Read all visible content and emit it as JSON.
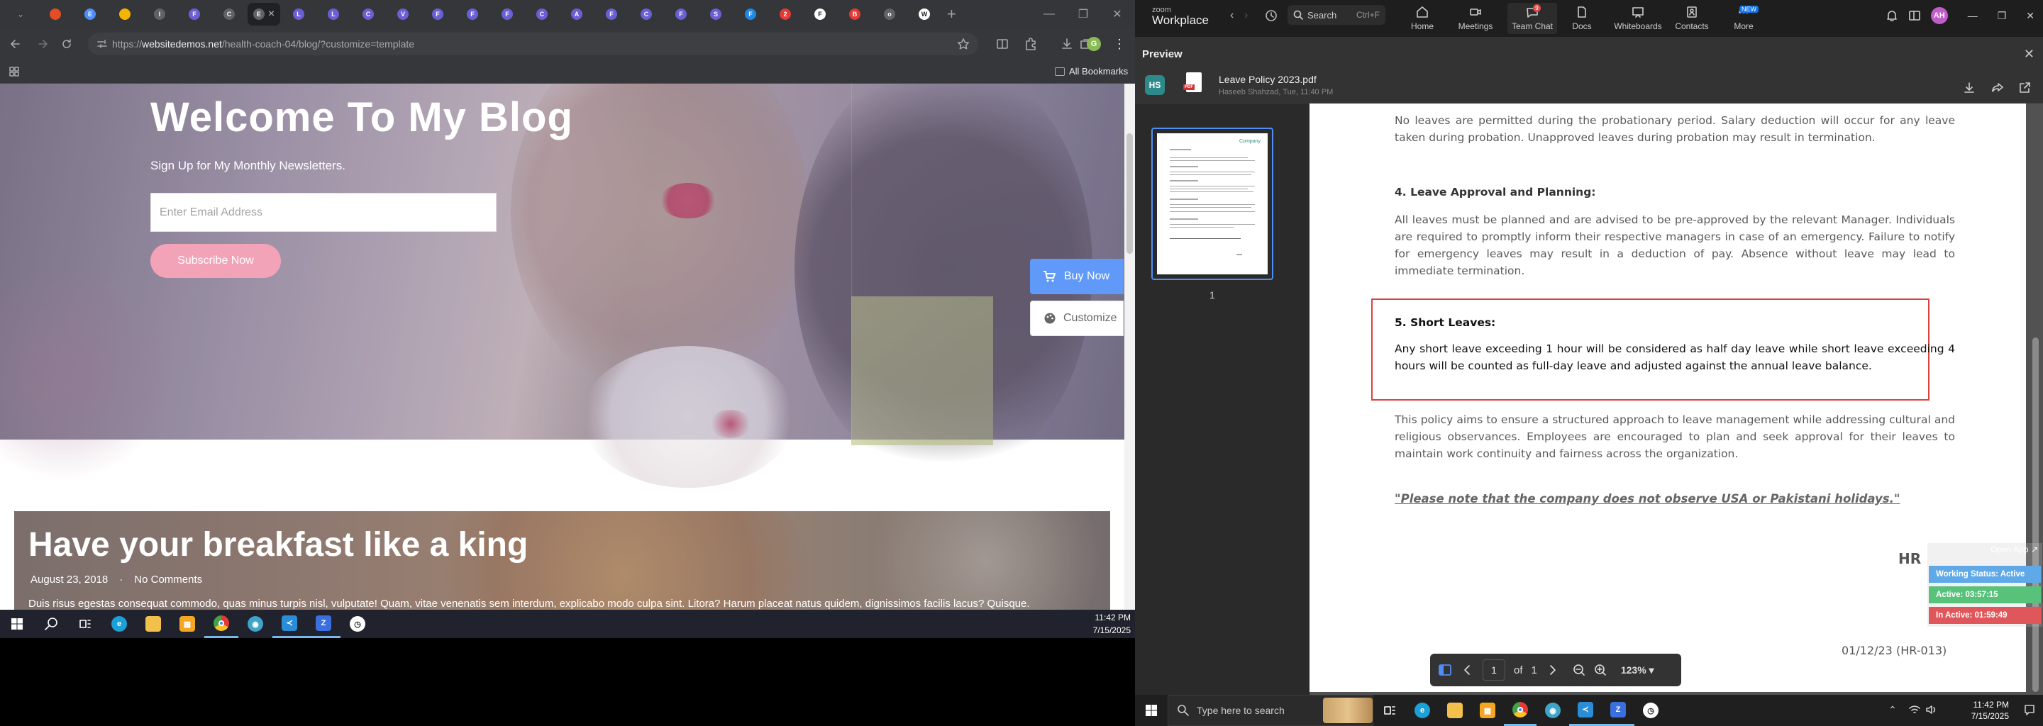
{
  "browser": {
    "tabs": [
      {
        "letter": "",
        "color": "#e44d26"
      },
      {
        "letter": "E",
        "color": "#4f8ef7"
      },
      {
        "letter": "",
        "color": "#f5b400"
      },
      {
        "letter": "I",
        "color": "#5f6368"
      },
      {
        "letter": "F",
        "color": "#6b5fd6"
      },
      {
        "letter": "C",
        "color": "#5f6368"
      },
      {
        "letter": "E",
        "color": "#5f6368"
      },
      {
        "letter": "L",
        "color": "#6b5fd6"
      },
      {
        "letter": "L",
        "color": "#6b5fd6"
      },
      {
        "letter": "C",
        "color": "#6b5fd6"
      },
      {
        "letter": "V",
        "color": "#6b5fd6"
      },
      {
        "letter": "F",
        "color": "#6b5fd6"
      },
      {
        "letter": "F",
        "color": "#6b5fd6"
      },
      {
        "letter": "F",
        "color": "#6b5fd6"
      },
      {
        "letter": "C",
        "color": "#6b5fd6"
      },
      {
        "letter": "A",
        "color": "#6b5fd6"
      },
      {
        "letter": "F",
        "color": "#6b5fd6"
      },
      {
        "letter": "C",
        "color": "#6b5fd6"
      },
      {
        "letter": "F",
        "color": "#6b5fd6"
      },
      {
        "letter": "S",
        "color": "#6b5fd6"
      },
      {
        "letter": "F",
        "color": "#1e88e5"
      },
      {
        "letter": "2",
        "color": "#e53935"
      },
      {
        "letter": "F",
        "color": "#fff"
      },
      {
        "letter": "B",
        "color": "#e53935"
      },
      {
        "letter": "o",
        "color": "#5f6368"
      },
      {
        "letter": "W",
        "color": "#fff"
      }
    ],
    "active_tab_index": 6,
    "url_prefix": "https://",
    "url_domain": "websitedemos.net",
    "url_path": "/health-coach-04/blog/?customize=template",
    "all_bookmarks": "All Bookmarks",
    "profile_initial": "G"
  },
  "hero": {
    "title": "Welcome To My Blog",
    "subtitle": "Sign Up for My Monthly Newsletters.",
    "email_placeholder": "Enter Email Address",
    "subscribe": "Subscribe Now"
  },
  "floating": {
    "buy_now": "Buy Now",
    "customize": "Customize"
  },
  "post": {
    "title": "Have your breakfast like a king",
    "date": "August 23, 2018",
    "sep": "·",
    "comments": "No Comments",
    "excerpt": "Duis risus egestas consequat commodo, quas minus turpis nisl, vulputate! Quam, vitae venenatis sem interdum, explicabo modo culpa sint. Litora? Harum placeat natus quidem, dignissimos facilis lacus? Quisque."
  },
  "left_taskbar": {
    "time": "11:42 PM",
    "date": "7/15/2025"
  },
  "zoom": {
    "logo_top": "zoom",
    "logo_bottom": "Workplace",
    "search": "Search",
    "search_shortcut": "Ctrl+F",
    "nav": [
      "Home",
      "Meetings",
      "Team Chat",
      "Docs",
      "Whiteboards",
      "Contacts",
      "More"
    ],
    "chat_badge": "9",
    "more_badge": "NEW",
    "avatar": "AH"
  },
  "preview": {
    "label": "Preview",
    "sender_initials": "HS",
    "file_name": "Leave Policy 2023.pdf",
    "file_meta": "Haseeb Shahzad, Tue, 11:40 PM",
    "page_number": "1",
    "thumb_label": "1",
    "page_of": "of",
    "page_total": "1",
    "zoom": "123%",
    "thumb_logo": "Company"
  },
  "document": {
    "para1": "No leaves are permitted during the probationary period. Salary deduction will occur for any leave taken during probation. Unapproved leaves during probation may result in termination.",
    "h4": "4. Leave Approval and Planning:",
    "para2": "All leaves must be planned and are advised to be pre-approved by the relevant Manager. Individuals are required to promptly inform their respective managers in case of an emergency. Failure to notify for emergency leaves may result in a deduction of pay. Absence without leave may lead to immediate termination.",
    "h5": "5. Short Leaves:",
    "para3": "Any short leave exceeding 1 hour will be considered as half day leave while short leave exceeding 4 hours will be counted as full-day leave and adjusted against the annual leave balance.",
    "para4": "This policy aims to ensure a structured approach to leave management while addressing cultural and religious observances. Employees are encouraged to plan and seek approval for their leaves to maintain work continuity and fairness across the organization.",
    "quote": "\"Please note that the company does not observe USA or Pakistani holidays.\"",
    "signature": "HR",
    "doc_date": "01/12/23 (HR-013)"
  },
  "status_widget": {
    "open_app": "Open App",
    "working": "Working Status: Active",
    "active": "Active: 03:57:15",
    "inactive": "In Active: 01:59:49"
  },
  "right_taskbar": {
    "search_placeholder": "Type here to search",
    "time": "11:42 PM",
    "date": "7/15/2025"
  },
  "colors": {
    "accent": "#4f8ef7",
    "subscribe": "#f299b0",
    "red_box": "#d9433f",
    "active_green": "#58c27a",
    "inactive_red": "#e0575b",
    "working_blue": "#5fa9e8"
  }
}
